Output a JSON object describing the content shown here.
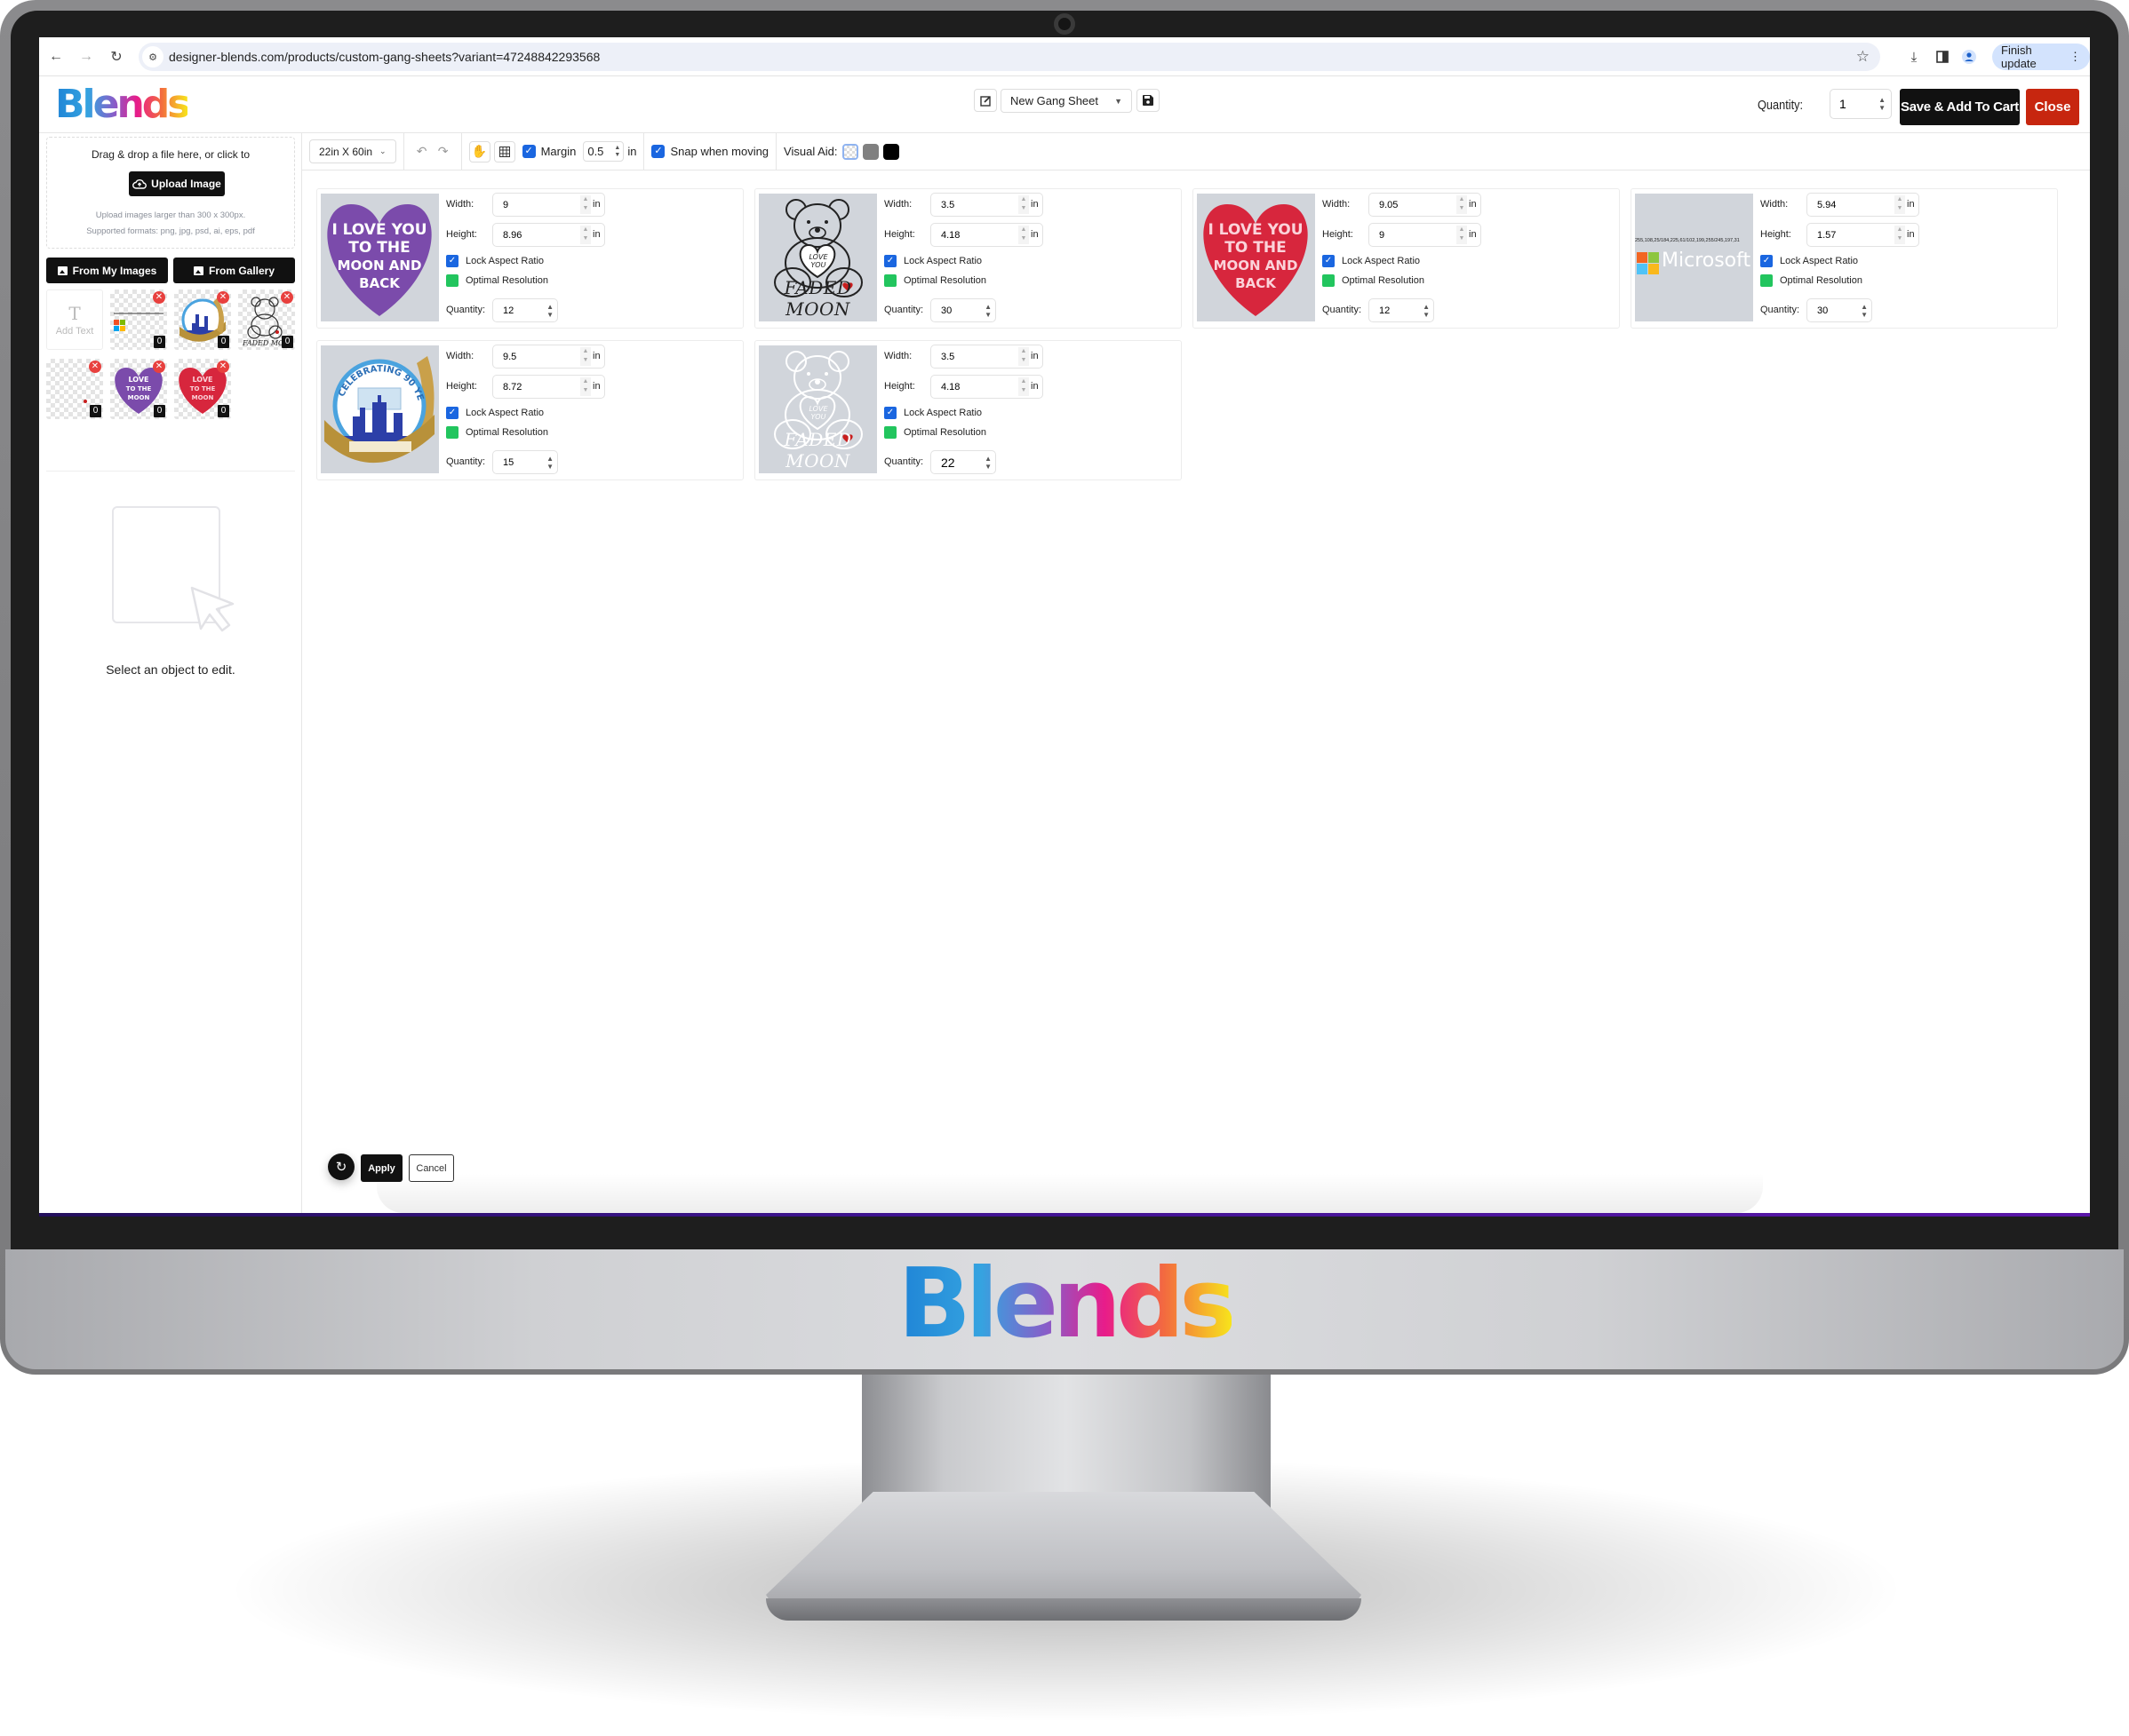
{
  "browser": {
    "url": "designer-blends.com/products/custom-gang-sheets?variant=47248842293568",
    "finish_update_label": "Finish update"
  },
  "header": {
    "logo_text": "Blends",
    "sheet_name": "New Gang Sheet",
    "quantity_label": "Quantity:",
    "quantity_value": "1",
    "save_add_to_cart_label": "Save & Add To Cart",
    "close_label": "Close"
  },
  "sidebar": {
    "dropzone_text": "Drag & drop a file here, or click to",
    "upload_button_label": "Upload Image",
    "upload_hint_1": "Upload images larger than 300 x 300px.",
    "upload_hint_2": "Supported formats: png, jpg, psd, ai, eps, pdf",
    "from_my_images_label": "From My Images",
    "from_gallery_label": "From Gallery",
    "add_text_label": "Add Text",
    "thumbnails": [
      {
        "name": "microsoft-logo",
        "count": "0"
      },
      {
        "name": "celebrating-90-years",
        "count": "0"
      },
      {
        "name": "faded-moon-bear-black",
        "count": "0"
      },
      {
        "name": "faded-moon-bear-white",
        "count": "0"
      },
      {
        "name": "love-you-heart-purple",
        "count": "0"
      },
      {
        "name": "love-you-heart-red",
        "count": "0"
      }
    ],
    "empty_state_text": "Select an object to edit."
  },
  "toolbar": {
    "sheet_size": "22in X 60in",
    "margin_label": "Margin",
    "margin_checked": true,
    "margin_value": "0.5",
    "margin_unit": "in",
    "snap_label": "Snap when moving",
    "snap_checked": true,
    "visual_aid_label": "Visual Aid:",
    "visual_aid_options": [
      "transparent",
      "#808080",
      "#000000"
    ],
    "visual_aid_selected": "transparent"
  },
  "labels": {
    "width": "Width:",
    "height": "Height:",
    "unit": "in",
    "lock_aspect": "Lock Aspect Ratio",
    "optimal_resolution": "Optimal Resolution",
    "quantity": "Quantity:"
  },
  "cards": [
    {
      "image": "love-you-heart-purple",
      "width": "9",
      "height": "8.96",
      "lock_aspect": true,
      "optimal_resolution": true,
      "quantity": "12"
    },
    {
      "image": "faded-moon-bear-black",
      "width": "3.5",
      "height": "4.18",
      "lock_aspect": true,
      "optimal_resolution": true,
      "quantity": "30"
    },
    {
      "image": "love-you-heart-red",
      "width": "9.05",
      "height": "9",
      "lock_aspect": true,
      "optimal_resolution": true,
      "quantity": "12"
    },
    {
      "image": "microsoft-logo",
      "width": "5.94",
      "height": "1.57",
      "lock_aspect": true,
      "optimal_resolution": true,
      "quantity": "30"
    },
    {
      "image": "celebrating-90-years",
      "width": "9.5",
      "height": "8.72",
      "lock_aspect": true,
      "optimal_resolution": true,
      "quantity": "15"
    },
    {
      "image": "faded-moon-bear-white",
      "width": "3.5",
      "height": "4.18",
      "lock_aspect": true,
      "optimal_resolution": true,
      "quantity": "22"
    }
  ],
  "preview_text": {
    "heart_lines": [
      "I LOVE YOU",
      "TO THE",
      "MOON AND",
      "BACK"
    ],
    "bear_heart": "LOVE YOU",
    "faded_moon": "FADED MOON",
    "microsoft_word": "Microsoft",
    "microsoft_tiny": "255,108,25/184,225,61/102,199,255/245,197,31",
    "celebrating": "CELEBRATING 90 YEARS"
  },
  "actions": {
    "apply_label": "Apply",
    "cancel_label": "Cancel"
  },
  "colors": {
    "primary_dark": "#111111",
    "close_red": "#c7260f",
    "checkbox_blue": "#1a66e0",
    "resolution_green": "#22c55e",
    "heart_purple": "#7b4bab",
    "heart_red": "#d7263d"
  },
  "monitor": {
    "chin_logo_text": "Blends"
  }
}
